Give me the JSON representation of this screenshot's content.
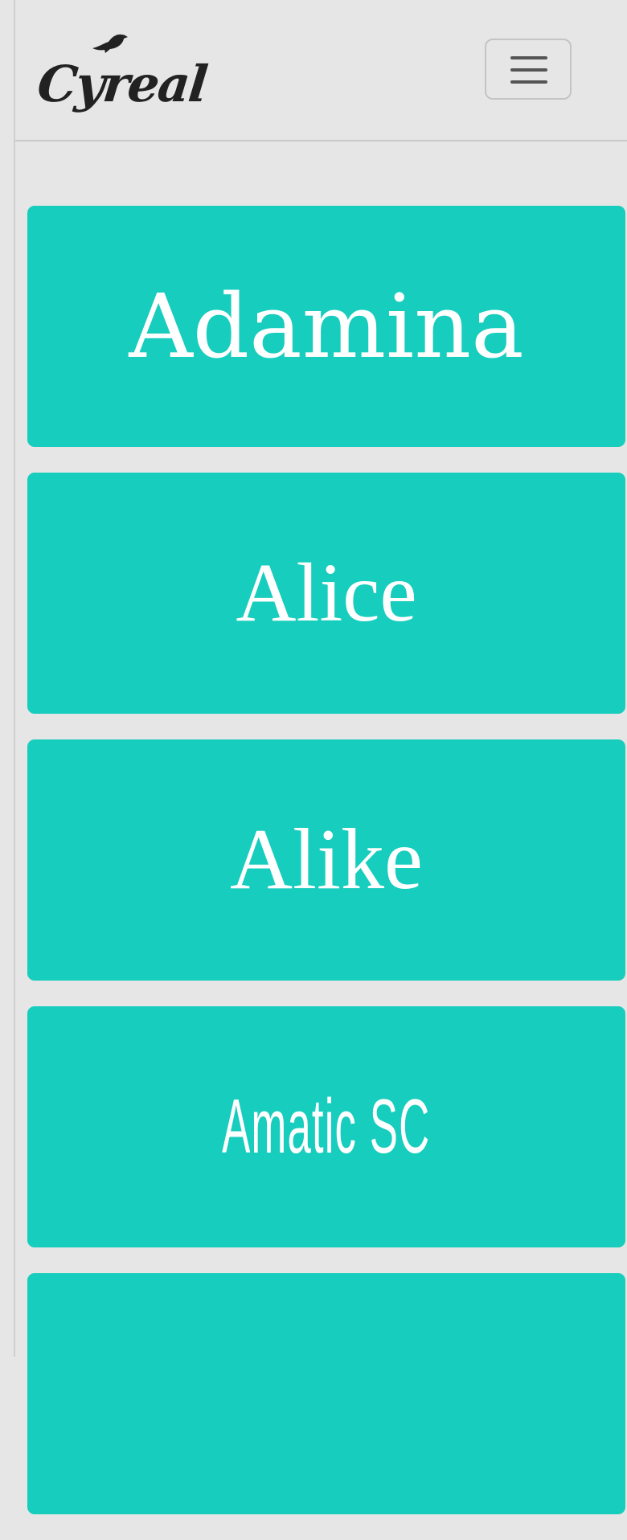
{
  "brand": {
    "logo_text": "Cyreal"
  },
  "navbar": {
    "toggle_icon": "hamburger-menu-icon"
  },
  "font_list": {
    "cards": [
      {
        "label": "Adamina"
      },
      {
        "label": "Alice"
      },
      {
        "label": "Alike"
      },
      {
        "label": "Amatic SC"
      },
      {
        "label": ""
      }
    ]
  },
  "colors": {
    "card_background": "#17cdbd",
    "card_text": "#ffffff",
    "page_background": "#e6e6e6",
    "logo_text": "#222222"
  }
}
